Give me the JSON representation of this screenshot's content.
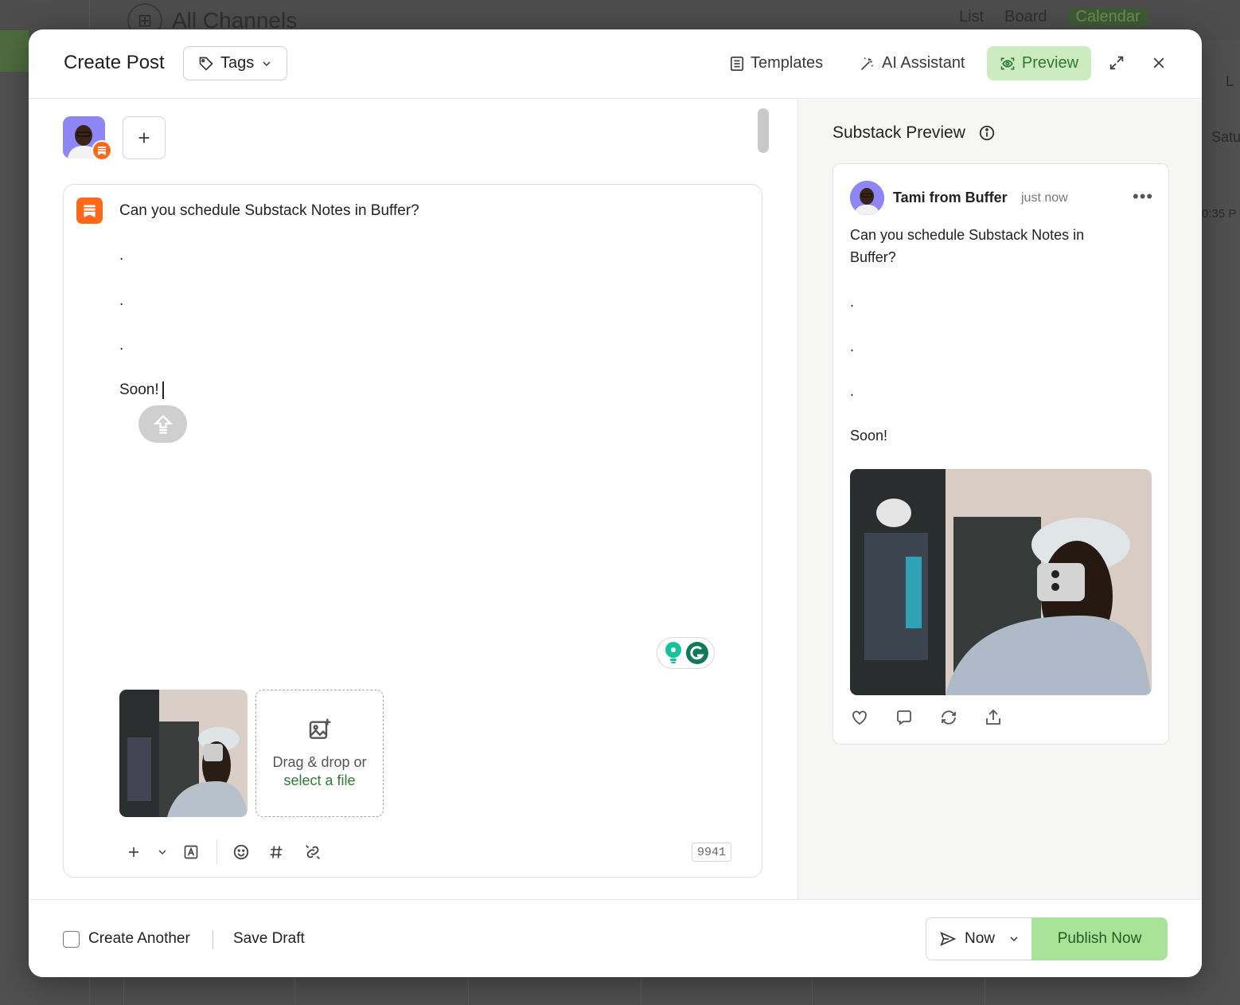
{
  "background": {
    "title": "All Channels",
    "views": [
      "List",
      "Board",
      "Calendar"
    ],
    "right_fragments": [
      "L",
      "Satu",
      "0:35 P"
    ]
  },
  "modal": {
    "title": "Create Post",
    "tags_label": "Tags",
    "templates_label": "Templates",
    "ai_assistant_label": "AI Assistant",
    "preview_label": "Preview"
  },
  "editor": {
    "lines": [
      "Can you schedule Substack Notes in Buffer?",
      ".",
      ".",
      ".",
      "Soon!"
    ],
    "dropzone": {
      "text": "Drag & drop or",
      "link": "select a file"
    },
    "char_count": "9941"
  },
  "preview": {
    "title": "Substack Preview",
    "author": "Tami from Buffer",
    "time": "just now",
    "text_lines": [
      "Can you schedule Substack Notes in Buffer?",
      "",
      ".",
      "",
      ".",
      "",
      ".",
      "",
      "Soon!"
    ]
  },
  "footer": {
    "create_another": "Create Another",
    "save_draft": "Save Draft",
    "now_label": "Now",
    "publish_label": "Publish Now"
  },
  "colors": {
    "accent_green": "#cdebc1",
    "publish_green": "#a9e39a",
    "substack_orange": "#ff6719"
  }
}
